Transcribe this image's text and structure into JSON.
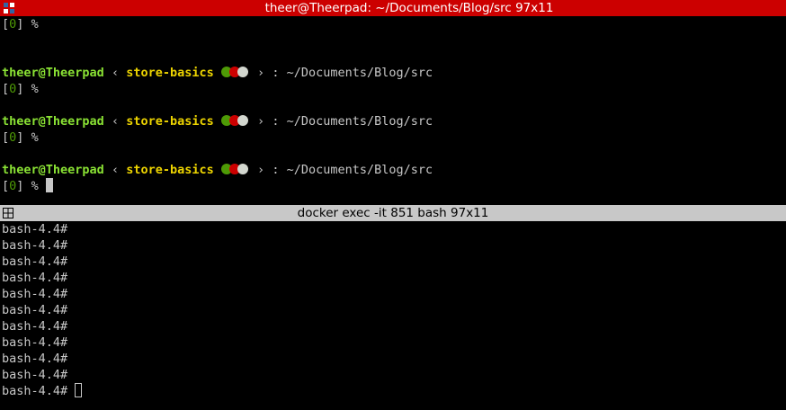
{
  "window": {
    "title": "theer@Theerpad: ~/Documents/Blog/src 97x11",
    "icon": "terminator-app-icon"
  },
  "top_pane": {
    "first_line": {
      "bracket_open": "[",
      "number": "0",
      "bracket_close": "]",
      "symbol": "%"
    },
    "prompt_blocks": [
      {
        "user_host": "theer@Theerpad",
        "chevron_left": "‹",
        "branch": "store-basics",
        "chevron_right": "›",
        "separator": ":",
        "path": "~/Documents/Blog/src",
        "status": {
          "bracket_open": "[",
          "number": "0",
          "bracket_close": "]",
          "symbol": "%"
        }
      },
      {
        "user_host": "theer@Theerpad",
        "chevron_left": "‹",
        "branch": "store-basics",
        "chevron_right": "›",
        "separator": ":",
        "path": "~/Documents/Blog/src",
        "status": {
          "bracket_open": "[",
          "number": "0",
          "bracket_close": "]",
          "symbol": "%"
        }
      },
      {
        "user_host": "theer@Theerpad",
        "chevron_left": "‹",
        "branch": "store-basics",
        "chevron_right": "›",
        "separator": ":",
        "path": "~/Documents/Blog/src",
        "status": {
          "bracket_open": "[",
          "number": "0",
          "bracket_close": "]",
          "symbol": "%"
        }
      }
    ],
    "status_dot_colors": [
      "#4e9a06",
      "#cc0000",
      "#d3d7cf"
    ]
  },
  "bottom_pane": {
    "title": "docker exec -it 851 bash 97x11",
    "split_icon": "split-pane-icon",
    "lines": [
      "bash-4.4#",
      "bash-4.4#",
      "bash-4.4#",
      "bash-4.4#",
      "bash-4.4#",
      "bash-4.4#",
      "bash-4.4#",
      "bash-4.4#",
      "bash-4.4#",
      "bash-4.4#",
      "bash-4.4#"
    ]
  },
  "colors": {
    "titlebar_bg": "#cc0000",
    "user_host": "#8ae234",
    "branch": "#edd400",
    "status_zero": "#4e9a06",
    "divider_bg": "#c8c8c8"
  }
}
